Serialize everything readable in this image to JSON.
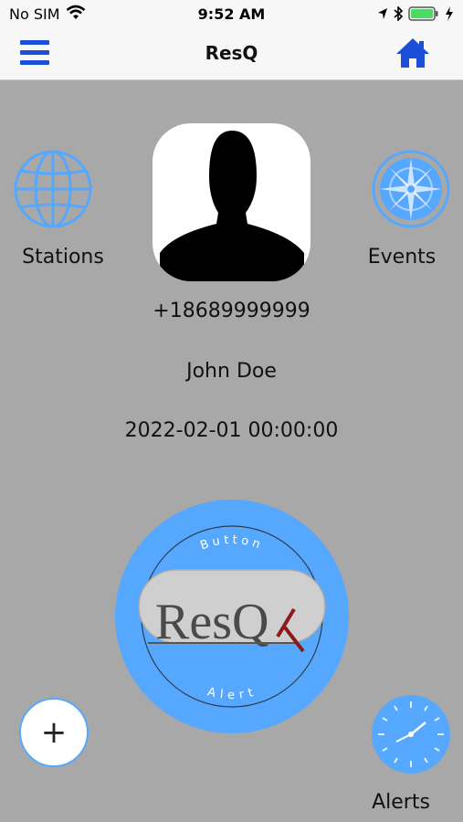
{
  "status_bar": {
    "carrier": "No SIM",
    "time": "9:52 AM"
  },
  "nav": {
    "title": "ResQ"
  },
  "stations": {
    "label": "Stations"
  },
  "events": {
    "label": "Events"
  },
  "profile": {
    "phone": "+18689999999",
    "name": "John Doe",
    "datetime": "2022-02-01 00:00:00"
  },
  "alert_button": {
    "top_text": "Button",
    "bottom_text": "Alert",
    "logo_text": "ResQ"
  },
  "add_button": {
    "symbol": "+"
  },
  "alerts": {
    "label": "Alerts"
  },
  "colors": {
    "accent_blue": "#56a8ff",
    "nav_blue": "#1b4fd9",
    "background": "#a8a8a8",
    "logo_red": "#8b1a1a"
  }
}
